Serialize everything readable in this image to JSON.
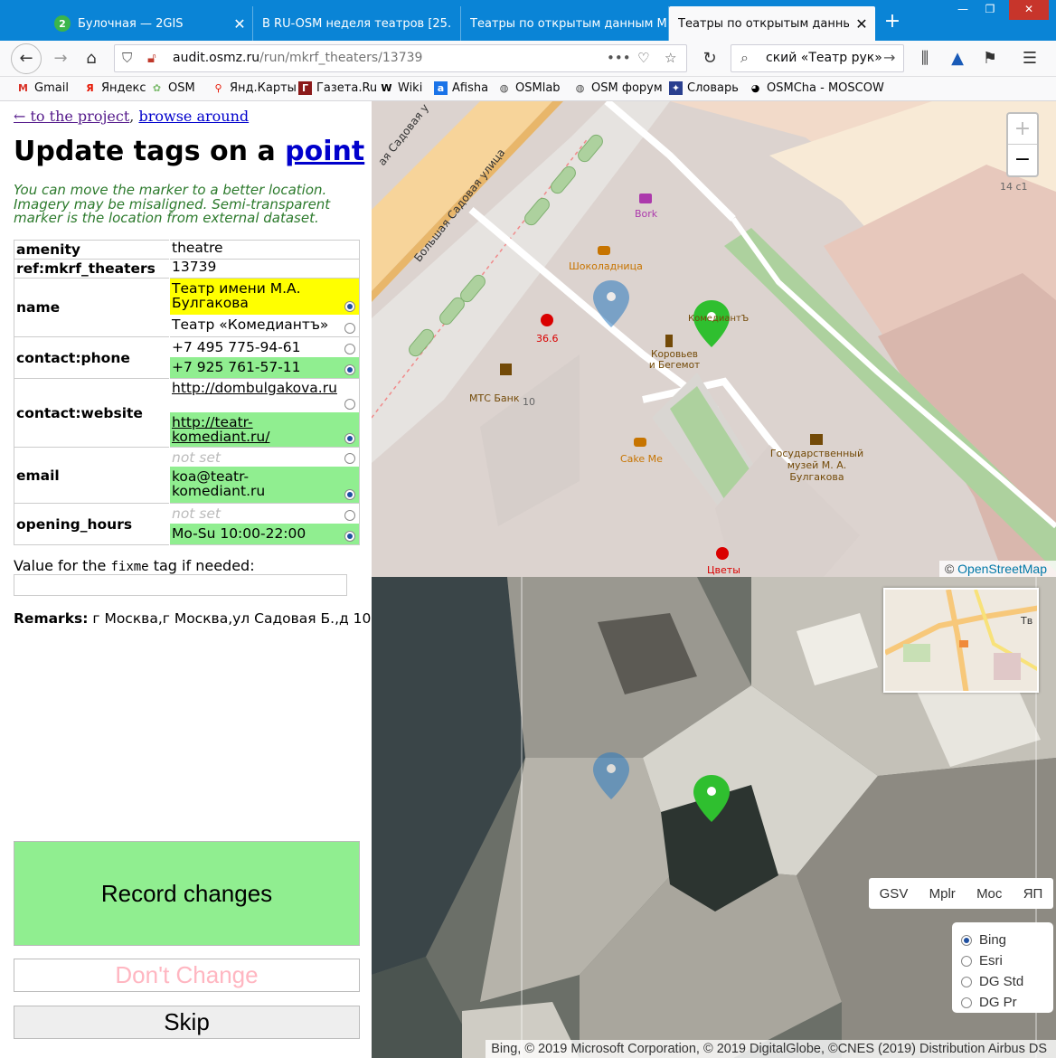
{
  "browser": {
    "tabs": [
      {
        "title": "Булочная — 2GIS",
        "favicon": "2"
      },
      {
        "title": "В RU-OSM неделя театров [25.",
        "favicon": ""
      },
      {
        "title": "Театры по открытым данным М",
        "favicon": ""
      },
      {
        "title": "Театры по открытым данным М",
        "favicon": ""
      }
    ],
    "new_tab_label": "+",
    "url_domain": "audit.osmz.ru",
    "url_path": "/run/mkrf_theaters/13739",
    "url_more": "•••",
    "search_text": "ский «Театр рук»",
    "bookmarks": [
      "Gmail",
      "Яндекс",
      "OSM",
      "Янд.Карты",
      "Газета.Ru",
      "Wiki",
      "Afisha",
      "OSMlab",
      "OSM форум",
      "Словарь",
      "OSMCha - MOSCOW"
    ],
    "accent_color": "#0a84d6"
  },
  "page": {
    "back_link": "← to the project",
    "separator": ",",
    "browse_link": "browse around",
    "title_prefix": "Update tags on a",
    "title_link": "point",
    "hint": "You can move the marker to a better location. Imagery may be misaligned. Semi-transparent marker is the location from external dataset.",
    "tags": {
      "amenity": {
        "key": "amenity",
        "value": "theatre"
      },
      "ref": {
        "key": "ref:mkrf_theaters",
        "value": "13739"
      },
      "name": {
        "key": "name",
        "opt1": "Театр имени М.А. Булгакова",
        "opt2": "Театр «Комедиантъ»"
      },
      "phone": {
        "key": "contact:phone",
        "opt1": "+7 495 775-94-61",
        "opt2": "+7 925 761-57-11"
      },
      "website": {
        "key": "contact:website",
        "opt1": "http://dombulgakova.ru",
        "opt2": "http://teatr-komediant.ru/"
      },
      "email": {
        "key": "email",
        "opt1": "not set",
        "opt2": "koa@teatr-komediant.ru"
      },
      "hours": {
        "key": "opening_hours",
        "opt1": "not set",
        "opt2": "Mo-Su 10:00-22:00"
      }
    },
    "fixme_label_prefix": "Value for the",
    "fixme_tag": "fixme",
    "fixme_label_suffix": "tag if needed:",
    "fixme_value": "",
    "remarks_label": "Remarks:",
    "remarks_value": "г Москва,г Москва,ул Садовая Б.,д 10",
    "btn_record": "Record changes",
    "btn_dont": "Don't Change",
    "btn_skip": "Skip"
  },
  "map_top": {
    "zoom_in": "+",
    "zoom_out": "−",
    "labels": {
      "street1": "Большая Садовая улица",
      "street2": "ая Садовая у",
      "bork": "Bork",
      "shokoladnitsa": "Шоколадница",
      "pharmacy": "36.6",
      "komediant": "КомедиантЪ",
      "korovev": "Коровьев и Бегемот",
      "mts": "МТС Банк",
      "house10": "10",
      "house14": "14 с1",
      "cakeme": "Cake Me",
      "museum": "Государственный музей М. А. Булгакова",
      "flowers": "Цветы"
    },
    "attribution_prefix": "©",
    "attribution_link": "OpenStreetMap"
  },
  "map_bottom": {
    "layer_buttons": [
      "GSV",
      "Mplr",
      "Moc",
      "ЯП"
    ],
    "imagery_options": [
      "Bing",
      "Esri",
      "DG Std",
      "DG Pr"
    ],
    "imagery_selected": "Bing",
    "minimap_label": "Тв",
    "attribution": "Bing, © 2019 Microsoft Corporation, © 2019 DigitalGlobe, ©CNES (2019) Distribution Airbus DS"
  }
}
